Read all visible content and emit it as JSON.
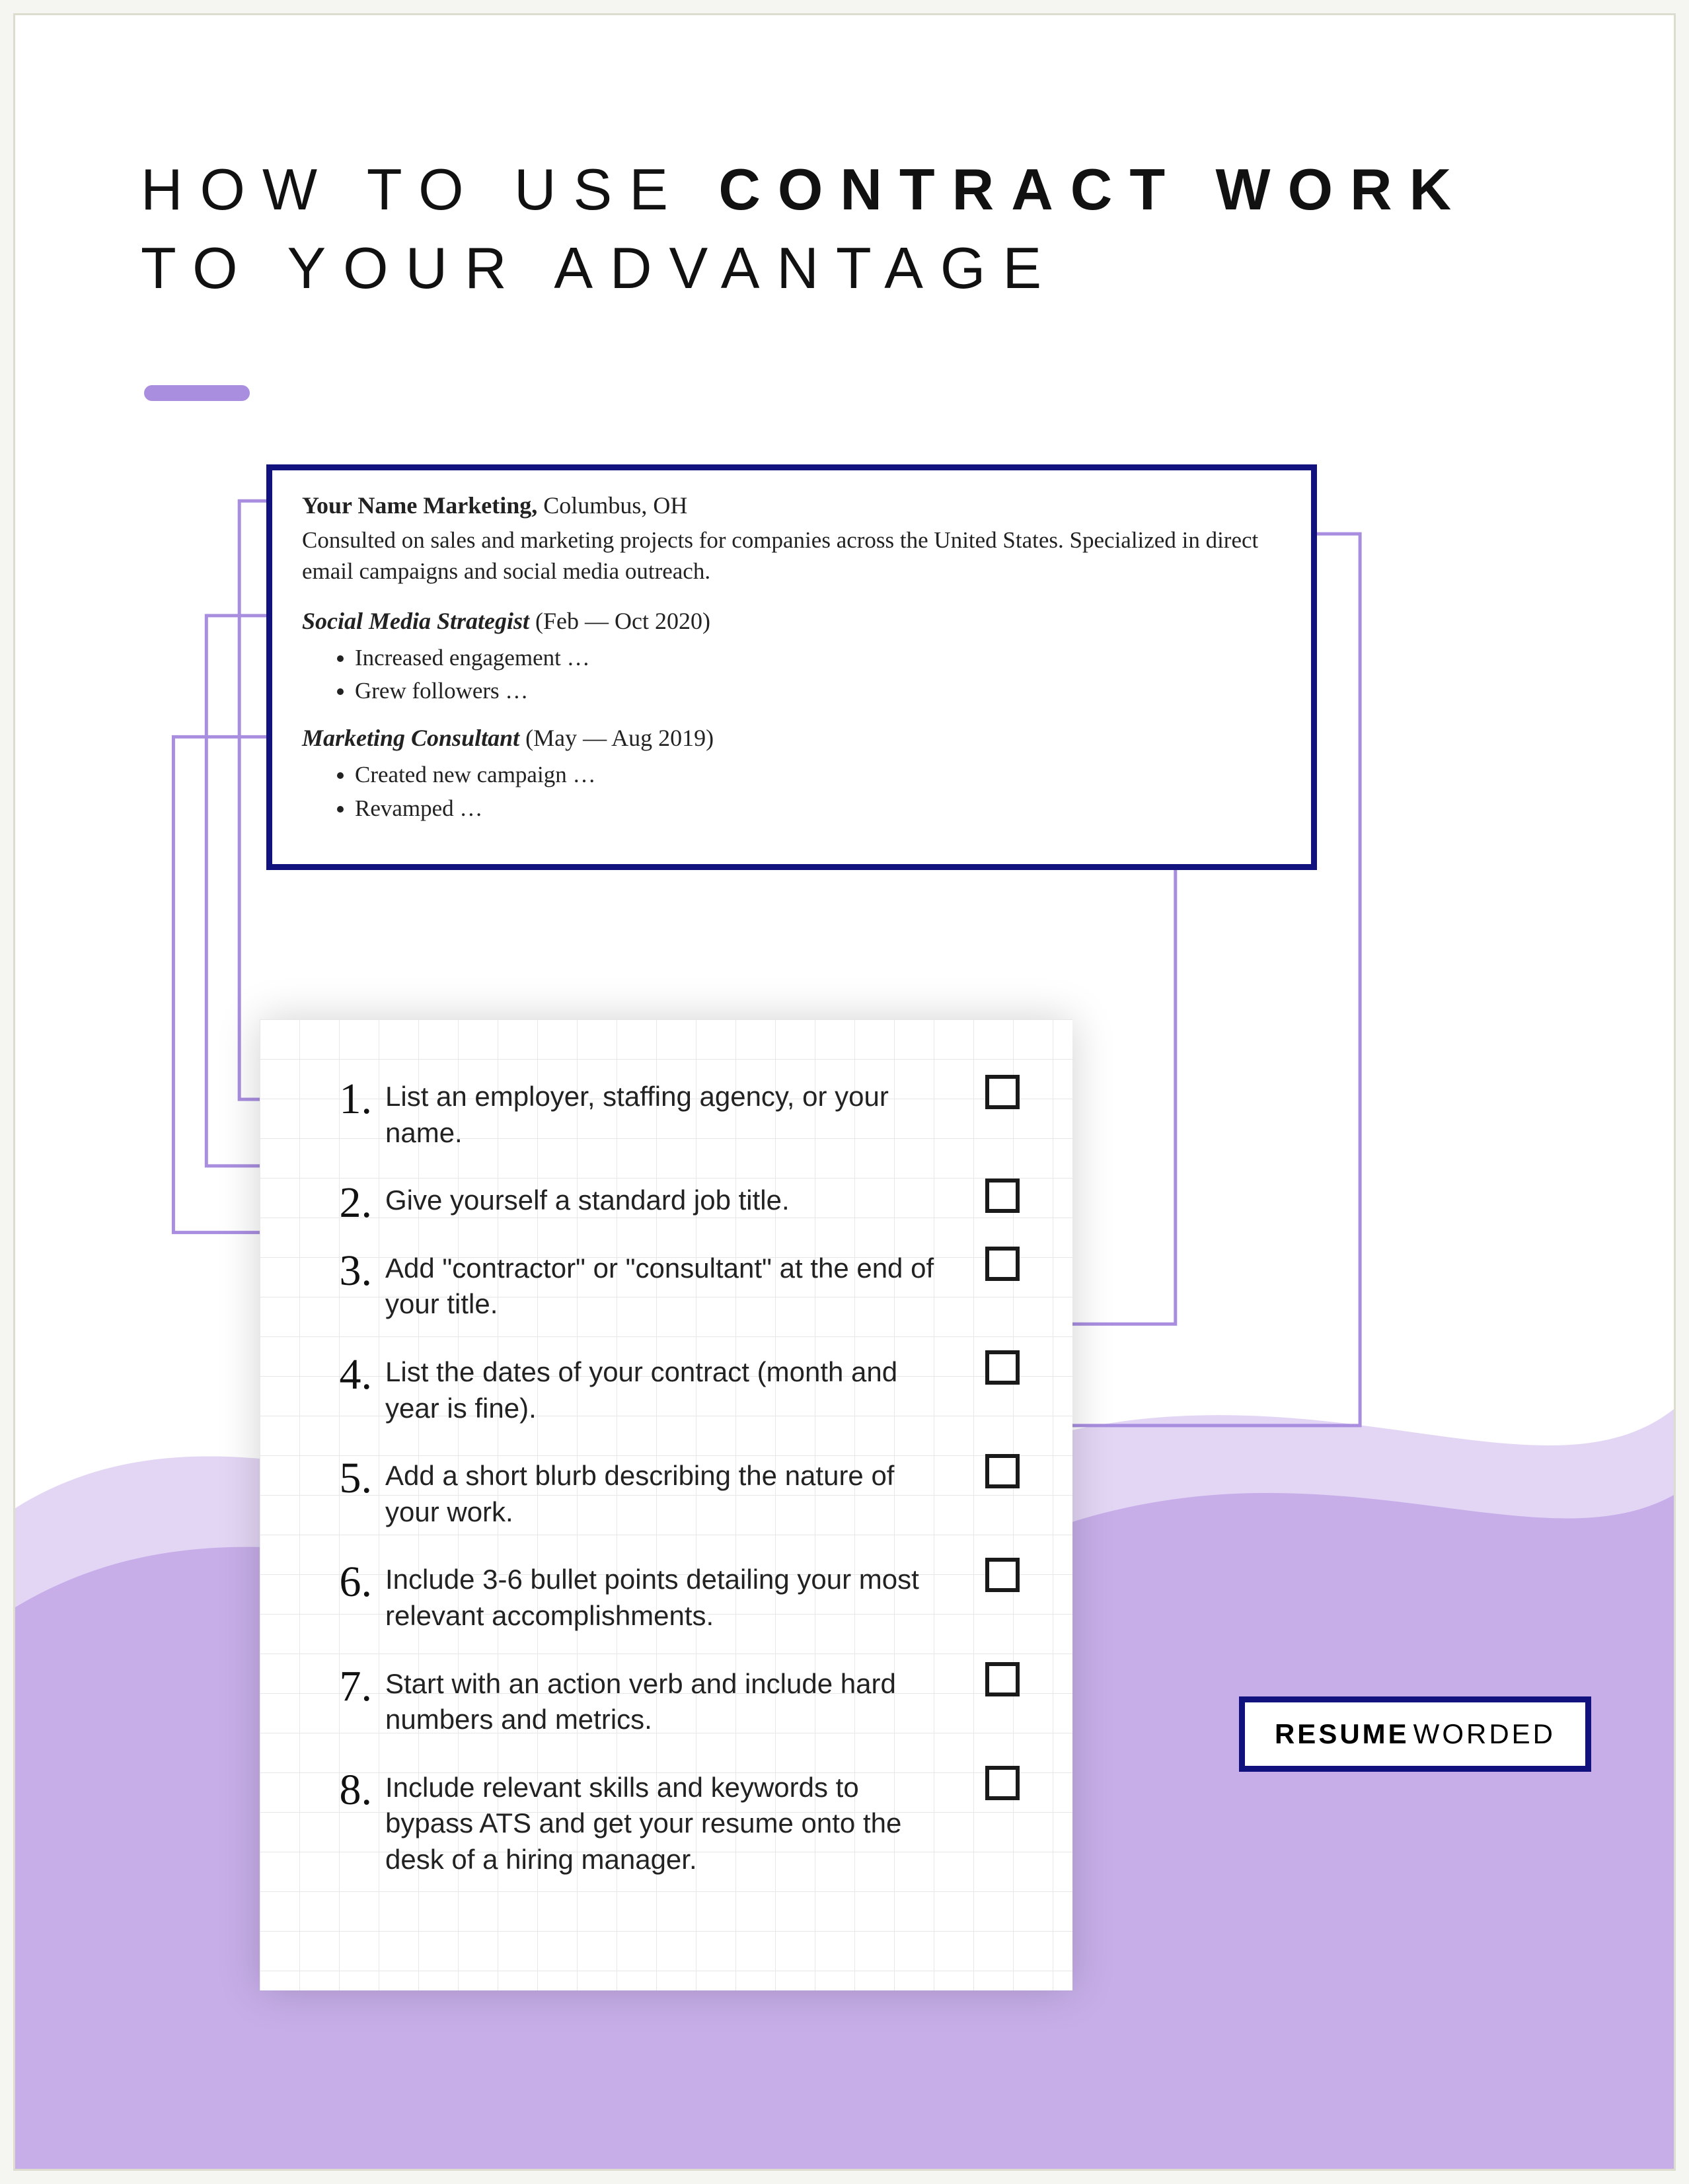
{
  "headline": {
    "pre": "HOW TO USE ",
    "bold": "CONTRACT WORK",
    "post": "TO YOUR ADVANTAGE"
  },
  "resume": {
    "company_name": "Your Name Marketing,",
    "company_loc": " Columbus, OH",
    "blurb": "Consulted on sales and marketing projects for companies across the United States. Specialized in direct email campaigns and social media outreach.",
    "role1_title": "Social Media Strategist",
    "role1_dates": " (Feb — Oct 2020)",
    "role1_b1": "Increased engagement …",
    "role1_b2": "Grew followers …",
    "role2_title": "Marketing Consultant",
    "role2_dates": " (May — Aug 2019)",
    "role2_b1": "Created new campaign …",
    "role2_b2": "Revamped …"
  },
  "checklist": {
    "n1": "1.",
    "t1": "List an employer, staffing agency, or your name.",
    "n2": "2.",
    "t2": "Give yourself a standard job title.",
    "n3": "3.",
    "t3": " Add \"contractor\" or \"consultant\" at the end of your title.",
    "n4": "4.",
    "t4": " List the dates of your contract (month and year is fine).",
    "n5": "5.",
    "t5": " Add a short blurb describing the nature of your work.",
    "n6": "6.",
    "t6": "Include 3-6 bullet points detailing your most relevant accomplishments.",
    "n7": "7.",
    "t7": "Start with an action verb and include hard numbers and metrics.",
    "n8": "8.",
    "t8": "Include relevant skills and keywords to bypass ATS and get your resume onto the desk of a hiring manager."
  },
  "brand": {
    "b1": "RESUME",
    "b2": "WORDED"
  },
  "colors": {
    "navy": "#12127e",
    "lilac_light": "#e3d6f5",
    "lilac_mid": "#c7aee9",
    "accent": "#a98ee0",
    "line": "#a98ee0"
  }
}
